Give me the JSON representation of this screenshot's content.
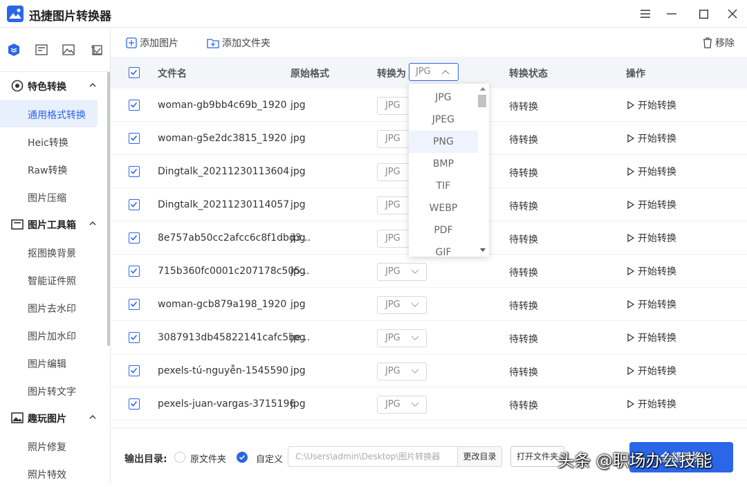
{
  "app": {
    "title": "迅捷图片转换器",
    "accent": "#2a66e8"
  },
  "window_controls": [
    "menu-icon",
    "minimize-icon",
    "maximize-icon",
    "close-icon"
  ],
  "sidebar": {
    "tool_icons": [
      "layers-icon",
      "picture-frame-icon",
      "image-icon",
      "crop-icon"
    ],
    "groups": [
      {
        "label": "特色转换",
        "icon": "target-icon",
        "items": [
          "通用格式转换",
          "Heic转换",
          "Raw转换",
          "图片压缩"
        ],
        "active": "通用格式转换"
      },
      {
        "label": "图片工具箱",
        "icon": "toolbox-icon",
        "items": [
          "抠图换背景",
          "智能证件照",
          "图片去水印",
          "图片加水印",
          "图片编辑",
          "图片转文字"
        ]
      },
      {
        "label": "趣玩图片",
        "icon": "fun-image-icon",
        "items": [
          "照片修复",
          "照片特效"
        ]
      }
    ]
  },
  "toolbar": {
    "add_image": "添加图片",
    "add_folder": "添加文件夹",
    "remove": "移除"
  },
  "table": {
    "headers": {
      "filename": "文件名",
      "orig_format": "原始格式",
      "convert_to": "转换为",
      "status": "转换状态",
      "action": "操作"
    },
    "header_select_value": "JPG",
    "rows": [
      {
        "name": "woman-gb9bb4c69b_1920",
        "format": "jpg",
        "target": "JPG",
        "status": "待转换",
        "action": "开始转换"
      },
      {
        "name": "woman-g5e2dc3815_1920",
        "format": "jpg",
        "target": "JPG",
        "status": "待转换",
        "action": "开始转换"
      },
      {
        "name": "Dingtalk_20211230113604",
        "format": "jpg",
        "target": "JPG",
        "status": "待转换",
        "action": "开始转换"
      },
      {
        "name": "Dingtalk_20211230114057",
        "format": "jpg",
        "target": "JPG",
        "status": "待转换",
        "action": "开始转换"
      },
      {
        "name": "8e757ab50cc2afcc6c8f1dbd3...",
        "format": "jpg",
        "target": "JPG",
        "status": "待转换",
        "action": "开始转换"
      },
      {
        "name": "715b360fc0001c207178c505...",
        "format": "jpg",
        "target": "JPG",
        "status": "待转换",
        "action": "开始转换"
      },
      {
        "name": "woman-gcb879a198_1920",
        "format": "jpg",
        "target": "JPG",
        "status": "待转换",
        "action": "开始转换"
      },
      {
        "name": "3087913db45822141cafc5be...",
        "format": "jpg",
        "target": "JPG",
        "status": "待转换",
        "action": "开始转换"
      },
      {
        "name": "pexels-tú-nguyễn-1545590",
        "format": "jpg",
        "target": "JPG",
        "status": "待转换",
        "action": "开始转换"
      },
      {
        "name": "pexels-juan-vargas-3715196",
        "format": "jpg",
        "target": "JPG",
        "status": "待转换",
        "action": "开始转换"
      }
    ]
  },
  "dropdown": {
    "options": [
      "JPG",
      "JPEG",
      "PNG",
      "BMP",
      "TIF",
      "WEBP",
      "PDF",
      "GIF"
    ],
    "hovered": "PNG"
  },
  "bottom": {
    "output_label": "输出目录:",
    "radio_original": "原文件夹",
    "radio_custom": "自定义",
    "selected_radio": "自定义",
    "path_value": "C:\\Users\\admin\\Desktop\\图片转换器",
    "change_dir": "更改目录",
    "open_folder": "打开文件夹",
    "convert_all": "全部转换"
  },
  "watermark": "头条 @职场办公技能"
}
